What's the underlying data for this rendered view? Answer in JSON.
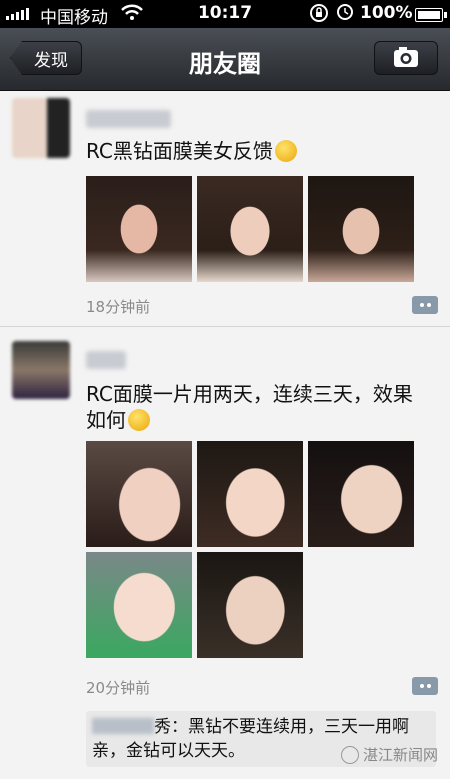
{
  "status_bar": {
    "carrier": "中国移动",
    "time": "10:17",
    "battery": "100%"
  },
  "nav": {
    "back_label": "发现",
    "title": "朋友圈"
  },
  "posts": [
    {
      "text": "RC黑钻面膜美女反馈",
      "time": "18分钟前"
    },
    {
      "text": "RC面膜一片用两天，连续三天，效果如何",
      "time": "20分钟前",
      "comment_suffix": "秀：黑钻不要连续用，三天一用啊亲，金钻可以天天。"
    }
  ],
  "watermark": "湛江新闻网",
  "colors": {
    "accent": "#8899aa",
    "nav_dark": "#26292d",
    "background": "#f3f3f3"
  }
}
